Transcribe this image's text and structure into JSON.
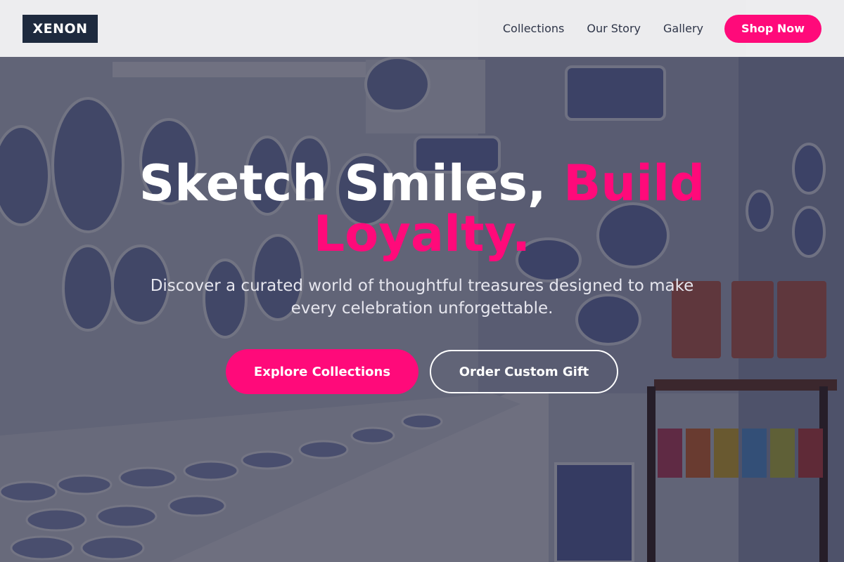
{
  "brand": {
    "logo_text": "XENON"
  },
  "nav": {
    "links": [
      "Collections",
      "Our Story",
      "Gallery"
    ],
    "shop_label": "Shop Now"
  },
  "hero": {
    "headline_white": "Sketch Smiles, ",
    "headline_accent": "Build Loyalty.",
    "subtext": "Discover a curated world of thoughtful treasures designed to make every celebration unforgettable.",
    "primary_cta": "Explore Collections",
    "secondary_cta": "Order Custom Gift",
    "background_image": "ceramics-shop-photo"
  },
  "colors": {
    "accent": "#ff0a7a",
    "navbar_bg": "#f2f2f4",
    "logo_bg": "#1e2a3e",
    "overlay": "#181a30"
  }
}
